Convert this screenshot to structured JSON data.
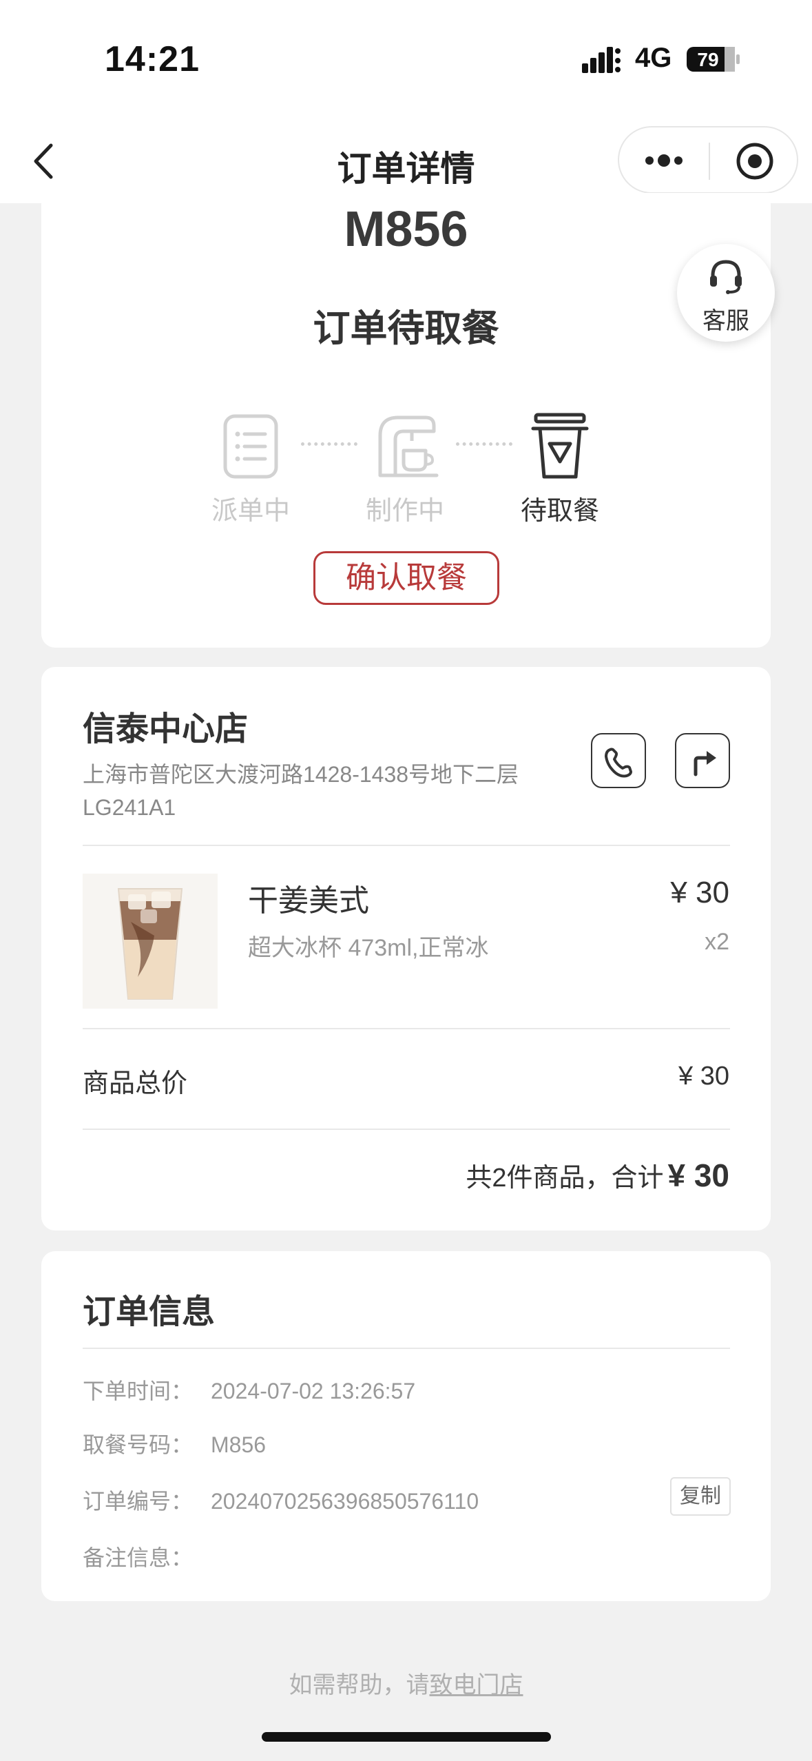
{
  "status_bar": {
    "time": "14:21",
    "network": "4G",
    "battery": "79"
  },
  "nav": {
    "title": "订单详情"
  },
  "order": {
    "code": "M856",
    "state": "订单待取餐",
    "service_label": "客服",
    "steps": [
      {
        "label": "派单中",
        "icon": "clipboard-icon",
        "state": "inactive"
      },
      {
        "label": "制作中",
        "icon": "coffee-machine-icon",
        "state": "inactive"
      },
      {
        "label": "待取餐",
        "icon": "cup-icon",
        "state": "active"
      }
    ],
    "confirm_label": "确认取餐"
  },
  "store": {
    "name": "信泰中心店",
    "address": "上海市普陀区大渡河路1428-1438号地下二层LG241A1",
    "product": {
      "name": "干姜美式",
      "spec": "超大冰杯 473ml,正常冰",
      "price": "¥ 30",
      "qty": "x2"
    },
    "subtotal_label": "商品总价",
    "subtotal_value": "¥ 30",
    "total_prefix": "共2件商品，合计",
    "total_value": "¥ 30"
  },
  "info": {
    "title": "订单信息",
    "rows": [
      {
        "key": "下单时间：",
        "value": "2024-07-02 13:26:57"
      },
      {
        "key": "取餐号码：",
        "value": "M856"
      },
      {
        "key": "订单编号：",
        "value": "20240702563968505761​10"
      },
      {
        "key": "备注信息：",
        "value": ""
      }
    ],
    "copy_label": "复制"
  },
  "help": {
    "prefix": "如需帮助，请",
    "link": "致电门店"
  },
  "colors": {
    "accent": "#b83a3a",
    "background": "#f1f1f1"
  }
}
